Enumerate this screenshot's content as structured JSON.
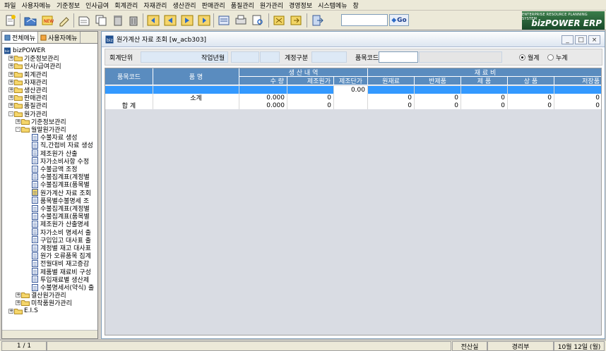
{
  "menubar": [
    "파일",
    "사용자메뉴",
    "기준정보",
    "인사급여",
    "회계관리",
    "자재관리",
    "생산관리",
    "판매관리",
    "품질관리",
    "원가관리",
    "경영정보",
    "시스템메뉴",
    "창"
  ],
  "toolbar": {
    "search_value": "",
    "go_label": "Go"
  },
  "logo": {
    "line1": "ENTERPRISE RESOURCE PLANNING SYSTEM",
    "line2": "bizPOWER ERP"
  },
  "left_tabs": [
    "전체메뉴",
    "사용자메뉴"
  ],
  "tree": [
    {
      "label": "bizPOWER",
      "level": 0,
      "kind": "root"
    },
    {
      "label": "기준정보관리",
      "level": 1,
      "kind": "folder",
      "pm": "+"
    },
    {
      "label": "인사/급여관리",
      "level": 1,
      "kind": "folder",
      "pm": "+"
    },
    {
      "label": "회계관리",
      "level": 1,
      "kind": "folder",
      "pm": "+"
    },
    {
      "label": "자재관리",
      "level": 1,
      "kind": "folder",
      "pm": "+"
    },
    {
      "label": "생산관리",
      "level": 1,
      "kind": "folder",
      "pm": "+"
    },
    {
      "label": "판매관리",
      "level": 1,
      "kind": "folder",
      "pm": "+"
    },
    {
      "label": "품질관리",
      "level": 1,
      "kind": "folder",
      "pm": "+"
    },
    {
      "label": "원가관리",
      "level": 1,
      "kind": "folder",
      "pm": "-"
    },
    {
      "label": "기준정보관리",
      "level": 2,
      "kind": "folder",
      "pm": "+"
    },
    {
      "label": "월말원가관리",
      "level": 2,
      "kind": "folder",
      "pm": "-"
    },
    {
      "label": "수불자료 생성",
      "level": 3,
      "kind": "doc"
    },
    {
      "label": "직,간접비 자료 생성",
      "level": 3,
      "kind": "doc"
    },
    {
      "label": "제조원가 산출",
      "level": 3,
      "kind": "doc"
    },
    {
      "label": "자가소비사항 수정",
      "level": 3,
      "kind": "doc"
    },
    {
      "label": "수불금액 조정",
      "level": 3,
      "kind": "doc"
    },
    {
      "label": "수불집계표(계정별",
      "level": 3,
      "kind": "doc"
    },
    {
      "label": "수불집계표(품목별",
      "level": 3,
      "kind": "doc"
    },
    {
      "label": "원가계산 자료 조회",
      "level": 3,
      "kind": "doc-active"
    },
    {
      "label": "품목별수불명세 조",
      "level": 3,
      "kind": "doc"
    },
    {
      "label": "수불집계표(계정별",
      "level": 3,
      "kind": "doc"
    },
    {
      "label": "수불집계표(품목별",
      "level": 3,
      "kind": "doc"
    },
    {
      "label": "제조원가 산출명세",
      "level": 3,
      "kind": "doc"
    },
    {
      "label": "자가소비 명세서 출",
      "level": 3,
      "kind": "doc"
    },
    {
      "label": "구입입고 대사표 출",
      "level": 3,
      "kind": "doc"
    },
    {
      "label": "계정별 재고 대사표",
      "level": 3,
      "kind": "doc"
    },
    {
      "label": "원가 오류품목 집계",
      "level": 3,
      "kind": "doc"
    },
    {
      "label": "전월대비 재고증감",
      "level": 3,
      "kind": "doc"
    },
    {
      "label": "제품별 재료비 구성",
      "level": 3,
      "kind": "doc"
    },
    {
      "label": "투입재료별 생산제",
      "level": 3,
      "kind": "doc"
    },
    {
      "label": "수불명세서(약식) 출",
      "level": 3,
      "kind": "doc"
    },
    {
      "label": "결산원가관리",
      "level": 2,
      "kind": "folder",
      "pm": "+"
    },
    {
      "label": "미착품원가관리",
      "level": 2,
      "kind": "folder",
      "pm": "+"
    },
    {
      "label": "E.I.S",
      "level": 1,
      "kind": "folder",
      "pm": "+"
    }
  ],
  "window": {
    "title": "원가계산 자료 조회 [w_acb303]",
    "min_label": "_",
    "max_label": "□",
    "close_label": "×"
  },
  "conditions": {
    "unit_label": "회계단위",
    "unit_value": "",
    "ym_label": "작업년월",
    "ym_value": "",
    "account_label": "계정구분",
    "account_value": "",
    "item_label": "품목코드",
    "item_value": "",
    "radio1": "월계",
    "radio2": "누계",
    "radio_selected": "월계"
  },
  "grid": {
    "headers_top": {
      "code": "품목코드",
      "name": "품     명",
      "production": "생 산 내 역",
      "material": "재   료   비"
    },
    "headers_sub": [
      "수  량",
      "제조원가",
      "제조단가",
      "원재료",
      "반제품",
      "제   품",
      "상   품",
      "저장품"
    ],
    "rows": [
      {
        "type": "selected",
        "code": "",
        "name": "",
        "qty": "",
        "cost": "",
        "unit": "0.00",
        "raw": "",
        "semi": "",
        "product": "",
        "goods": "",
        "stored": ""
      },
      {
        "type": "subtotal",
        "code": "",
        "name": "소계",
        "qty": "0.000",
        "cost": "0",
        "unit": "",
        "raw": "0",
        "semi": "0",
        "product": "0",
        "goods": "0",
        "stored": "0"
      },
      {
        "type": "total",
        "code": "합   계",
        "name": "",
        "qty": "0.000",
        "cost": "0",
        "unit": "",
        "raw": "0",
        "semi": "0",
        "product": "0",
        "goods": "0",
        "stored": "0"
      }
    ]
  },
  "status": {
    "page": "1 / 1",
    "dept": "전산실",
    "user": "경리부",
    "date": "10월 12일 (월)"
  }
}
